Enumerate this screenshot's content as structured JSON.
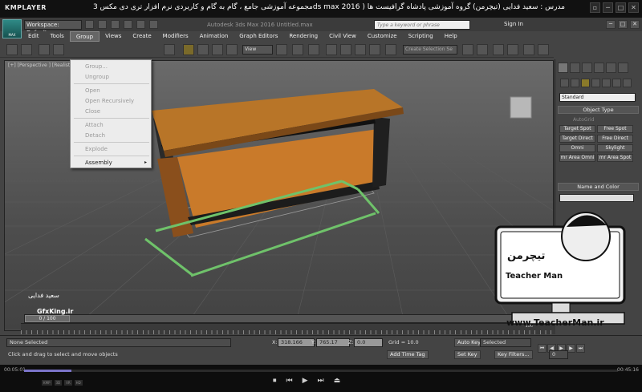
{
  "player": {
    "logo": "KMPLAYER",
    "caption": "مجموعه آموزشی جامع ، گام به گام و کاربردی نرم افزار تری دی مکس 3ds max 2016 ) مدرس : سعید فدایی (تیچرمن) گروه آموزشی پادشاه گرافیست ها",
    "window_buttons": [
      "▫",
      "─",
      "□",
      "✕"
    ],
    "time_elapsed": "00:05:01",
    "time_total": "00:45:16",
    "progress_fraction": 0.08,
    "controls": [
      "⏹",
      "⏮",
      "▶",
      "⏭",
      "⏏"
    ],
    "badges": [
      "KMP",
      "3D",
      "VR",
      "HD"
    ]
  },
  "max": {
    "logo_label": "MAX",
    "workspace": "Workspace: Default",
    "caption": "Autodesk 3ds Max 2016    Untitled.max",
    "search_placeholder": "Type a keyword or phrase",
    "sign_in": "Sign In",
    "window_buttons": [
      "─",
      "□",
      "✕"
    ],
    "menu": [
      "Edit",
      "Tools",
      "Group",
      "Views",
      "Create",
      "Modifiers",
      "Animation",
      "Graph Editors",
      "Rendering",
      "Civil View",
      "Customize",
      "Scripting",
      "Help"
    ],
    "active_menu": "Group",
    "view_dropdown": "View",
    "selection_set": "Create Selection Se"
  },
  "viewport": {
    "label": "[+] [Perspective ] [Realistic ]"
  },
  "group_menu": {
    "items": [
      {
        "label": "Group...",
        "enabled": false
      },
      {
        "label": "Ungroup",
        "enabled": false
      },
      {
        "label": "Open",
        "enabled": false
      },
      {
        "label": "Open Recursively",
        "enabled": false
      },
      {
        "label": "Close",
        "enabled": false
      },
      {
        "label": "Attach",
        "enabled": false
      },
      {
        "label": "Detach",
        "enabled": false
      },
      {
        "label": "Explode",
        "enabled": false
      },
      {
        "label": "Assembly",
        "enabled": true
      }
    ],
    "submenu_arrow": "▸"
  },
  "command_panel": {
    "category": "Standard",
    "object_type_title": "Object Type",
    "autogrid": "AutoGrid",
    "buttons": [
      "Target Spot",
      "Free Spot",
      "Target Direct",
      "Free Direct",
      "Omni",
      "Skylight",
      "mr Area Omni",
      "mr Area Spot"
    ],
    "name_color_title": "Name and Color"
  },
  "timeline": {
    "frame_display": "0 / 100",
    "ruler_end": "100"
  },
  "status": {
    "selection": "None Selected",
    "prompt": "Click and drag to select and move objects",
    "x_label": "X:",
    "x_value": "318.166",
    "y_label": "Y:",
    "y_value": "765.17",
    "z_label": "Z:",
    "z_value": "0.0",
    "grid": "Grid = 10.0",
    "add_time_tag": "Add Time Tag",
    "auto_key": "Auto Key",
    "set_key": "Set Key",
    "selected": "Selected",
    "key_filters": "Key Filters...",
    "frame_field": "0"
  },
  "overlays": {
    "teacher_url": "www.TeacherMan.ir",
    "signature_name": "سعید فدایی",
    "gfxking": "GfxKing.ir",
    "teacher_logo_text": "Teacher Man",
    "teacher_logo_farsi": "تیچرمن"
  }
}
